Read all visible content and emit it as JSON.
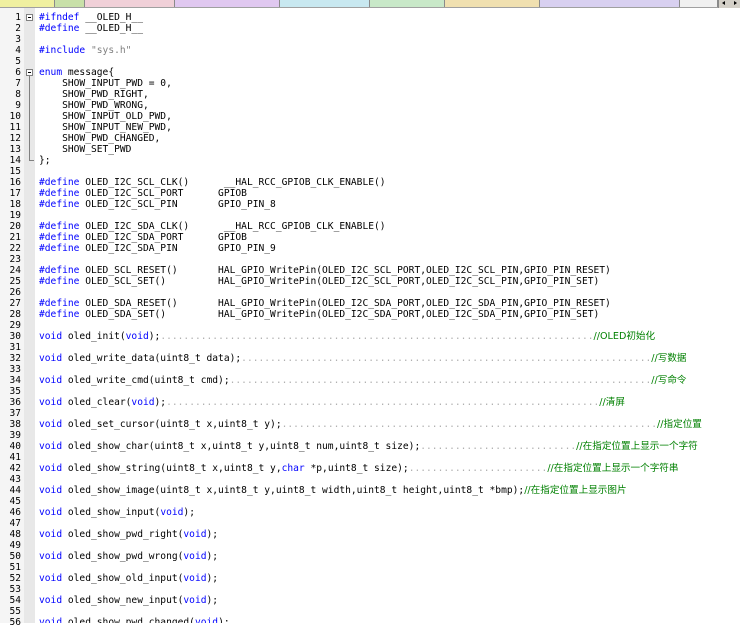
{
  "tab_colors": [
    "#f0f0a0",
    "#c8e0a8",
    "#f0d0d8",
    "#e0c8f0",
    "#c8e8f0",
    "#c8e8c8",
    "#f0e0b0",
    "#d8d0f0",
    "#f0f0f0"
  ],
  "syntax_colors": {
    "keyword": "#0000ff",
    "comment": "#008000",
    "string": "#808080",
    "text": "#000000",
    "whitespace_marker": "#b0b0b0"
  },
  "code_lines": [
    {
      "n": "1",
      "parts": [
        [
          "kw",
          "#ifndef"
        ],
        [
          "t",
          " __OLED_H__"
        ]
      ],
      "fold": "start"
    },
    {
      "n": "2",
      "parts": [
        [
          "kw",
          "#define"
        ],
        [
          "t",
          " __OLED_H__"
        ]
      ]
    },
    {
      "n": "3",
      "parts": []
    },
    {
      "n": "4",
      "parts": [
        [
          "kw",
          "#include"
        ],
        [
          "t",
          " "
        ],
        [
          "str",
          "\"sys.h\""
        ]
      ]
    },
    {
      "n": "5",
      "parts": []
    },
    {
      "n": "6",
      "parts": [
        [
          "kw",
          "enum"
        ],
        [
          "t",
          " message{"
        ]
      ],
      "fold": "start"
    },
    {
      "n": "7",
      "parts": [
        [
          "t",
          "    SHOW_INPUT_PWD = 0,"
        ]
      ]
    },
    {
      "n": "8",
      "parts": [
        [
          "t",
          "    SHOW_PWD_RIGHT,"
        ]
      ]
    },
    {
      "n": "9",
      "parts": [
        [
          "t",
          "    SHOW_PWD_WRONG,"
        ]
      ]
    },
    {
      "n": "10",
      "parts": [
        [
          "t",
          "    SHOW_INPUT_OLD_PWD,"
        ]
      ]
    },
    {
      "n": "11",
      "parts": [
        [
          "t",
          "    SHOW_INPUT_NEW_PWD,"
        ]
      ]
    },
    {
      "n": "12",
      "parts": [
        [
          "t",
          "    SHOW_PWD_CHANGED,"
        ]
      ]
    },
    {
      "n": "13",
      "parts": [
        [
          "t",
          "    SHOW_SET_PWD"
        ]
      ]
    },
    {
      "n": "14",
      "parts": [
        [
          "t",
          "};"
        ]
      ],
      "fold": "end"
    },
    {
      "n": "15",
      "parts": []
    },
    {
      "n": "16",
      "parts": [
        [
          "kw",
          "#define"
        ],
        [
          "t",
          " OLED_I2C_SCL_CLK()      __HAL_RCC_GPIOB_CLK_ENABLE()"
        ]
      ]
    },
    {
      "n": "17",
      "parts": [
        [
          "kw",
          "#define"
        ],
        [
          "t",
          " OLED_I2C_SCL_PORT      GPIOB"
        ]
      ]
    },
    {
      "n": "18",
      "parts": [
        [
          "kw",
          "#define"
        ],
        [
          "t",
          " OLED_I2C_SCL_PIN       GPIO_PIN_8"
        ]
      ]
    },
    {
      "n": "19",
      "parts": []
    },
    {
      "n": "20",
      "parts": [
        [
          "kw",
          "#define"
        ],
        [
          "t",
          " OLED_I2C_SDA_CLK()      __HAL_RCC_GPIOB_CLK_ENABLE()"
        ]
      ]
    },
    {
      "n": "21",
      "parts": [
        [
          "kw",
          "#define"
        ],
        [
          "t",
          " OLED_I2C_SDA_PORT      GPIOB"
        ]
      ]
    },
    {
      "n": "22",
      "parts": [
        [
          "kw",
          "#define"
        ],
        [
          "t",
          " OLED_I2C_SDA_PIN       GPIO_PIN_9"
        ]
      ]
    },
    {
      "n": "23",
      "parts": []
    },
    {
      "n": "24",
      "parts": [
        [
          "kw",
          "#define"
        ],
        [
          "t",
          " OLED_SCL_RESET()       HAL_GPIO_WritePin(OLED_I2C_SCL_PORT,OLED_I2C_SCL_PIN,GPIO_PIN_RESET)"
        ]
      ]
    },
    {
      "n": "25",
      "parts": [
        [
          "kw",
          "#define"
        ],
        [
          "t",
          " OLED_SCL_SET()         HAL_GPIO_WritePin(OLED_I2C_SCL_PORT,OLED_I2C_SCL_PIN,GPIO_PIN_SET)"
        ]
      ]
    },
    {
      "n": "26",
      "parts": []
    },
    {
      "n": "27",
      "parts": [
        [
          "kw",
          "#define"
        ],
        [
          "t",
          " OLED_SDA_RESET()       HAL_GPIO_WritePin(OLED_I2C_SDA_PORT,OLED_I2C_SDA_PIN,GPIO_PIN_RESET)"
        ]
      ]
    },
    {
      "n": "28",
      "parts": [
        [
          "kw",
          "#define"
        ],
        [
          "t",
          " OLED_SDA_SET()         HAL_GPIO_WritePin(OLED_I2C_SDA_PORT,OLED_I2C_SDA_PIN,GPIO_PIN_SET)"
        ]
      ]
    },
    {
      "n": "29",
      "parts": []
    },
    {
      "n": "30",
      "parts": [
        [
          "kw",
          "void"
        ],
        [
          "t",
          " oled_init("
        ],
        [
          "kw",
          "void"
        ],
        [
          "t",
          ");"
        ],
        [
          "dots",
          "..........................................................................."
        ],
        [
          "cmt",
          "//OLED初始化"
        ]
      ]
    },
    {
      "n": "31",
      "parts": []
    },
    {
      "n": "32",
      "parts": [
        [
          "kw",
          "void"
        ],
        [
          "t",
          " oled_write_data(uint8_t data);"
        ],
        [
          "dots",
          "......................................................................."
        ],
        [
          "cmt",
          "//写数据"
        ]
      ]
    },
    {
      "n": "33",
      "parts": []
    },
    {
      "n": "34",
      "parts": [
        [
          "kw",
          "void"
        ],
        [
          "t",
          " oled_write_cmd(uint8_t cmd);"
        ],
        [
          "dots",
          "........................................................................."
        ],
        [
          "cmt",
          "//写命令"
        ]
      ]
    },
    {
      "n": "35",
      "parts": []
    },
    {
      "n": "36",
      "parts": [
        [
          "kw",
          "void"
        ],
        [
          "t",
          " oled_clear("
        ],
        [
          "kw",
          "void"
        ],
        [
          "t",
          ");"
        ],
        [
          "dots",
          "..........................................................................."
        ],
        [
          "cmt",
          "//清屏"
        ]
      ]
    },
    {
      "n": "37",
      "parts": []
    },
    {
      "n": "38",
      "parts": [
        [
          "kw",
          "void"
        ],
        [
          "t",
          " oled_set_cursor(uint8_t x,uint8_t y);"
        ],
        [
          "dots",
          "................................................................."
        ],
        [
          "cmt",
          "//指定位置"
        ]
      ]
    },
    {
      "n": "39",
      "parts": []
    },
    {
      "n": "40",
      "parts": [
        [
          "kw",
          "void"
        ],
        [
          "t",
          " oled_show_char(uint8_t x,uint8_t y,uint8_t num,uint8_t size);"
        ],
        [
          "dots",
          "..........................."
        ],
        [
          "cmt",
          "//在指定位置上显示一个字符"
        ]
      ]
    },
    {
      "n": "41",
      "parts": []
    },
    {
      "n": "42",
      "parts": [
        [
          "kw",
          "void"
        ],
        [
          "t",
          " oled_show_string(uint8_t x,uint8_t y,"
        ],
        [
          "kw",
          "char"
        ],
        [
          "t",
          " *p,uint8_t size);"
        ],
        [
          "dots",
          "........................"
        ],
        [
          "cmt",
          "//在指定位置上显示一个字符串"
        ]
      ]
    },
    {
      "n": "43",
      "parts": []
    },
    {
      "n": "44",
      "parts": [
        [
          "kw",
          "void"
        ],
        [
          "t",
          " oled_show_image(uint8_t x,uint8_t y,uint8_t width,uint8_t height,uint8_t *bmp);"
        ],
        [
          "cmt",
          "//在指定位置上显示图片"
        ]
      ]
    },
    {
      "n": "45",
      "parts": []
    },
    {
      "n": "46",
      "parts": [
        [
          "kw",
          "void"
        ],
        [
          "t",
          " oled_show_input("
        ],
        [
          "kw",
          "void"
        ],
        [
          "t",
          ");"
        ]
      ]
    },
    {
      "n": "47",
      "parts": []
    },
    {
      "n": "48",
      "parts": [
        [
          "kw",
          "void"
        ],
        [
          "t",
          " oled_show_pwd_right("
        ],
        [
          "kw",
          "void"
        ],
        [
          "t",
          ");"
        ]
      ]
    },
    {
      "n": "49",
      "parts": []
    },
    {
      "n": "50",
      "parts": [
        [
          "kw",
          "void"
        ],
        [
          "t",
          " oled_show_pwd_wrong("
        ],
        [
          "kw",
          "void"
        ],
        [
          "t",
          ");"
        ]
      ]
    },
    {
      "n": "51",
      "parts": []
    },
    {
      "n": "52",
      "parts": [
        [
          "kw",
          "void"
        ],
        [
          "t",
          " oled_show_old_input("
        ],
        [
          "kw",
          "void"
        ],
        [
          "t",
          ");"
        ]
      ]
    },
    {
      "n": "53",
      "parts": []
    },
    {
      "n": "54",
      "parts": [
        [
          "kw",
          "void"
        ],
        [
          "t",
          " oled_show_new_input("
        ],
        [
          "kw",
          "void"
        ],
        [
          "t",
          ");"
        ]
      ]
    },
    {
      "n": "55",
      "parts": []
    },
    {
      "n": "56",
      "parts": [
        [
          "kw",
          "void"
        ],
        [
          "t",
          " oled_show_pwd_changed("
        ],
        [
          "kw",
          "void"
        ],
        [
          "t",
          ");"
        ]
      ]
    }
  ]
}
